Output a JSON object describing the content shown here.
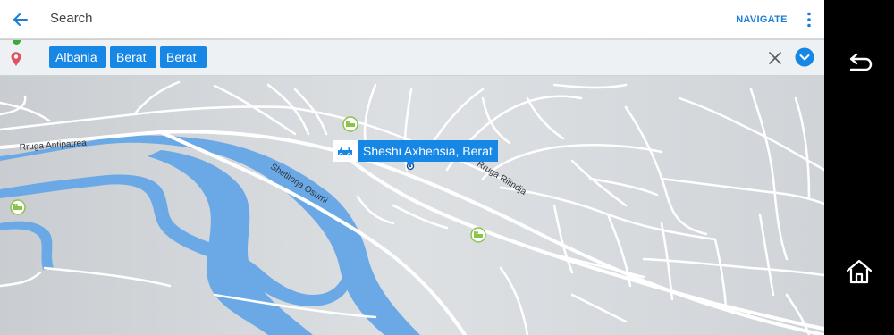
{
  "topbar": {
    "title": "Search",
    "navigate_label": "NAVIGATE",
    "back_icon": "arrow-left-icon",
    "more_icon": "more-vert-icon"
  },
  "search": {
    "chips": [
      "Albania",
      "Berat",
      "Berat"
    ],
    "clear_icon": "close-icon",
    "expand_icon": "chevron-down-icon"
  },
  "map": {
    "place_label": "Sheshi Axhensia, Berat",
    "place_icon": "car-icon",
    "streets": [
      "Rruga Antipatrea",
      "Shetitorja Osumi",
      "Rruga Rilindja"
    ],
    "poi_icon": "hotel-bed-icon"
  },
  "system_nav": {
    "back_icon": "system-back-icon",
    "home_icon": "system-home-icon"
  },
  "colors": {
    "accent": "#1787e6",
    "river": "#6aa9e6",
    "map_bg": "#d7dbde",
    "road": "#ffffff",
    "poi": "#8bc34a"
  }
}
